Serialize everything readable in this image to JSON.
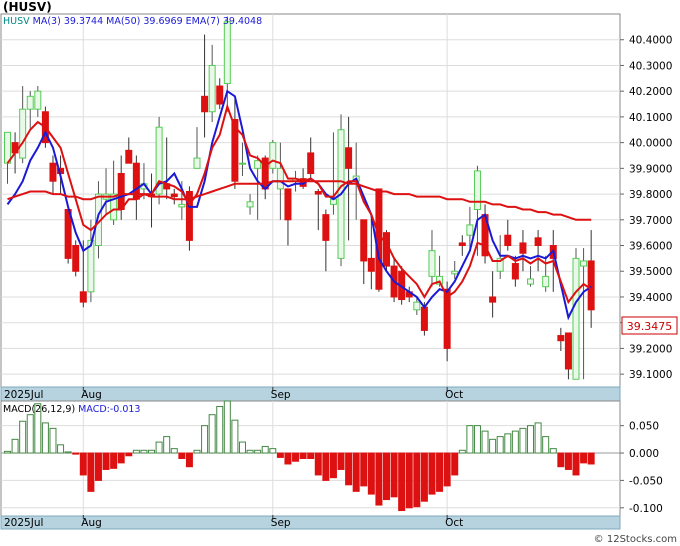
{
  "title": "(HUSV)",
  "watermark": "© 12Stocks.com",
  "colors": {
    "up": "#55cc55",
    "up_fill": "#eaf8ea",
    "down": "#dd1111",
    "ma3": "#1a1ad6",
    "ma50": "#dd1111",
    "ema7": "#dd1111",
    "macd_up": "#448844",
    "macd_down": "#dd1111",
    "axisbar": "#b7d3e0",
    "price_box": "#cc0000"
  },
  "chart_data": [
    {
      "type": "candlestick",
      "ticker": "HUSV",
      "legend": [
        {
          "label": "HUSV",
          "color": "#008888"
        },
        {
          "label": "MA(3)",
          "value": "39.3744",
          "color": "#1a1ad6"
        },
        {
          "label": "MA(50)",
          "value": "39.6969",
          "color": "#1a1ad6"
        },
        {
          "label": "EMA(7)",
          "value": "39.4048",
          "color": "#1a1ad6"
        }
      ],
      "last_price": "39.3475",
      "ylim": [
        39.05,
        40.5
      ],
      "yticks": [
        "39.1000",
        "39.2000",
        "39.3000",
        "39.4000",
        "39.5000",
        "39.6000",
        "39.7000",
        "39.8000",
        "39.9000",
        "40.0000",
        "40.1000",
        "40.2000",
        "40.3000",
        "40.4000"
      ],
      "xticks": [
        {
          "label": "2025Jul",
          "index": -0.5
        },
        {
          "label": "Aug",
          "index": 10
        },
        {
          "label": "Sep",
          "index": 35
        },
        {
          "label": "Oct",
          "index": 58
        }
      ],
      "candles": [
        [
          39.92,
          40.04,
          40.04,
          39.84
        ],
        [
          40.0,
          39.96,
          40.04,
          39.88
        ],
        [
          39.94,
          40.13,
          40.22,
          39.92
        ],
        [
          40.13,
          40.18,
          40.2,
          40.05
        ],
        [
          40.13,
          40.2,
          40.22,
          40.1
        ],
        [
          40.12,
          40.0,
          40.14,
          39.98
        ],
        [
          39.92,
          39.85,
          39.95,
          39.8
        ],
        [
          39.9,
          39.88,
          39.95,
          39.8
        ],
        [
          39.74,
          39.55,
          39.75,
          39.53
        ],
        [
          39.6,
          39.5,
          39.62,
          39.48
        ],
        [
          39.42,
          39.38,
          39.62,
          39.36
        ],
        [
          39.42,
          39.62,
          39.7,
          39.38
        ],
        [
          39.6,
          39.8,
          39.85,
          39.55
        ],
        [
          39.78,
          39.8,
          39.9,
          39.72
        ],
        [
          39.7,
          39.8,
          39.93,
          39.68
        ],
        [
          39.88,
          39.74,
          39.95,
          39.7
        ],
        [
          39.97,
          39.92,
          40.02,
          39.92
        ],
        [
          39.92,
          39.78,
          39.95,
          39.7
        ],
        [
          39.82,
          39.84,
          39.92,
          39.78
        ],
        [
          39.8,
          39.79,
          39.88,
          39.67
        ],
        [
          39.8,
          40.06,
          40.1,
          39.76
        ],
        [
          39.84,
          39.82,
          40.02,
          39.78
        ],
        [
          39.8,
          39.79,
          39.82,
          39.76
        ],
        [
          39.75,
          39.76,
          39.85,
          39.7
        ],
        [
          39.81,
          39.62,
          39.83,
          39.58
        ],
        [
          39.9,
          39.94,
          40.06,
          39.9
        ],
        [
          40.18,
          40.12,
          40.42,
          40.02
        ],
        [
          40.12,
          40.3,
          40.38,
          40.08
        ],
        [
          40.22,
          40.15,
          40.25,
          40.13
        ],
        [
          40.23,
          40.47,
          40.49,
          40.12
        ],
        [
          40.09,
          39.85,
          40.17,
          39.82
        ],
        [
          39.92,
          39.92,
          40.0,
          39.87
        ],
        [
          39.75,
          39.77,
          39.8,
          39.72
        ],
        [
          39.9,
          39.93,
          39.95,
          39.7
        ],
        [
          39.94,
          39.82,
          39.95,
          39.78
        ],
        [
          39.9,
          40.0,
          40.01,
          39.88
        ],
        [
          39.82,
          39.9,
          40.0,
          39.7
        ],
        [
          39.82,
          39.7,
          39.82,
          39.6
        ],
        [
          39.85,
          39.86,
          39.89,
          39.81
        ],
        [
          39.86,
          39.83,
          39.9,
          39.82
        ],
        [
          39.96,
          39.88,
          40.02,
          39.86
        ],
        [
          39.81,
          39.8,
          39.82,
          39.66
        ],
        [
          39.72,
          39.62,
          39.74,
          39.5
        ],
        [
          39.76,
          39.78,
          40.04,
          39.72
        ],
        [
          39.55,
          40.05,
          40.11,
          39.52
        ],
        [
          39.98,
          39.9,
          40.1,
          39.62
        ],
        [
          39.85,
          39.87,
          40.0,
          39.7
        ],
        [
          39.7,
          39.54,
          39.7,
          39.45
        ],
        [
          39.55,
          39.5,
          39.72,
          39.43
        ],
        [
          39.82,
          39.43,
          39.82,
          39.42
        ],
        [
          39.65,
          39.52,
          39.66,
          39.5
        ],
        [
          39.52,
          39.4,
          39.55,
          39.38
        ],
        [
          39.5,
          39.39,
          39.52,
          39.37
        ],
        [
          39.42,
          39.4,
          39.44,
          39.38
        ],
        [
          39.35,
          39.38,
          39.4,
          39.33
        ],
        [
          39.36,
          39.27,
          39.38,
          39.25
        ],
        [
          39.48,
          39.58,
          39.66,
          39.44
        ],
        [
          39.45,
          39.48,
          39.56,
          39.44
        ],
        [
          39.43,
          39.2,
          39.46,
          39.15
        ],
        [
          39.49,
          39.5,
          39.54,
          39.47
        ],
        [
          39.61,
          39.6,
          39.64,
          39.56
        ],
        [
          39.64,
          39.68,
          39.75,
          39.58
        ],
        [
          39.74,
          39.89,
          39.91,
          39.56
        ],
        [
          39.72,
          39.56,
          39.76,
          39.53
        ],
        [
          39.4,
          39.38,
          39.5,
          39.32
        ],
        [
          39.5,
          39.55,
          39.64,
          39.47
        ],
        [
          39.64,
          39.6,
          39.7,
          39.58
        ],
        [
          39.53,
          39.47,
          39.56,
          39.44
        ],
        [
          39.61,
          39.57,
          39.66,
          39.5
        ],
        [
          39.45,
          39.47,
          39.52,
          39.44
        ],
        [
          39.63,
          39.6,
          39.66,
          39.5
        ],
        [
          39.44,
          39.48,
          39.56,
          39.42
        ],
        [
          39.6,
          39.55,
          39.66,
          39.42
        ],
        [
          39.25,
          39.23,
          39.28,
          39.19
        ],
        [
          39.26,
          39.12,
          39.26,
          39.08
        ],
        [
          39.08,
          39.55,
          39.59,
          39.09
        ],
        [
          39.52,
          39.54,
          39.59,
          39.08
        ],
        [
          39.54,
          39.35,
          39.66,
          39.28
        ]
      ],
      "series": [
        {
          "name": "MA(3)",
          "values": [
            39.76,
            39.8,
            39.85,
            39.93,
            39.98,
            40.04,
            39.98,
            39.87,
            39.75,
            39.65,
            39.58,
            39.6,
            39.72,
            39.77,
            39.78,
            39.79,
            39.8,
            39.82,
            39.84,
            39.8,
            39.84,
            39.85,
            39.88,
            39.82,
            39.75,
            39.75,
            39.85,
            40.0,
            40.1,
            40.2,
            40.18,
            40.05,
            39.9,
            39.85,
            39.82,
            39.85,
            39.85,
            39.83,
            39.84,
            39.84,
            39.86,
            39.84,
            39.8,
            39.78,
            39.8,
            39.84,
            39.86,
            39.79,
            39.72,
            39.55,
            39.5,
            39.46,
            39.44,
            39.42,
            39.4,
            39.36,
            39.4,
            39.43,
            39.42,
            39.46,
            39.52,
            39.58,
            39.7,
            39.72,
            39.62,
            39.56,
            39.56,
            39.55,
            39.56,
            39.55,
            39.56,
            39.55,
            39.58,
            39.45,
            39.32,
            39.38,
            39.42,
            39.44
          ]
        },
        {
          "name": "MA(50)",
          "values": [
            39.78,
            39.79,
            39.8,
            39.81,
            39.81,
            39.81,
            39.8,
            39.8,
            39.79,
            39.79,
            39.78,
            39.78,
            39.79,
            39.79,
            39.79,
            39.8,
            39.8,
            39.8,
            39.8,
            39.79,
            39.79,
            39.79,
            39.78,
            39.78,
            39.78,
            39.79,
            39.8,
            39.81,
            39.82,
            39.83,
            39.84,
            39.84,
            39.84,
            39.84,
            39.84,
            39.85,
            39.85,
            39.85,
            39.85,
            39.85,
            39.85,
            39.85,
            39.85,
            39.85,
            39.85,
            39.84,
            39.84,
            39.83,
            39.82,
            39.81,
            39.81,
            39.8,
            39.8,
            39.8,
            39.79,
            39.79,
            39.79,
            39.79,
            39.78,
            39.78,
            39.78,
            39.77,
            39.77,
            39.77,
            39.76,
            39.76,
            39.75,
            39.75,
            39.74,
            39.74,
            39.73,
            39.73,
            39.72,
            39.72,
            39.71,
            39.7,
            39.7,
            39.7
          ]
        },
        {
          "name": "EMA(7)",
          "values": [
            39.92,
            39.96,
            40.0,
            40.05,
            40.08,
            40.06,
            40.02,
            39.98,
            39.88,
            39.78,
            39.68,
            39.66,
            39.69,
            39.72,
            39.74,
            39.74,
            39.78,
            39.78,
            39.8,
            39.8,
            39.85,
            39.84,
            39.83,
            39.81,
            39.76,
            39.8,
            39.88,
            39.98,
            40.03,
            40.14,
            40.06,
            40.03,
            39.95,
            39.94,
            39.91,
            39.93,
            39.92,
            39.86,
            39.86,
            39.85,
            39.86,
            39.84,
            39.79,
            39.79,
            39.83,
            39.85,
            39.85,
            39.77,
            39.72,
            39.64,
            39.61,
            39.55,
            39.51,
            39.48,
            39.45,
            39.4,
            39.45,
            39.46,
            39.4,
            39.42,
            39.46,
            39.52,
            39.61,
            39.6,
            39.54,
            39.54,
            39.56,
            39.54,
            39.55,
            39.53,
            39.55,
            39.53,
            39.54,
            39.46,
            39.38,
            39.42,
            39.45,
            39.43
          ]
        }
      ]
    },
    {
      "type": "bar",
      "legend": [
        {
          "label": "MACD(26,12,9)",
          "color": "#000000"
        },
        {
          "label": "MACD:-0.013",
          "color": "#1a1ad6"
        }
      ],
      "ylim": [
        -0.115,
        0.095
      ],
      "yticks": [
        "0.050",
        "0.000",
        "-0.050",
        "-0.100"
      ],
      "xticks": [
        {
          "label": "2025Jul",
          "index": -0.5
        },
        {
          "label": "Aug",
          "index": 10
        },
        {
          "label": "Sep",
          "index": 35
        },
        {
          "label": "Oct",
          "index": 58
        }
      ],
      "values": [
        0.003,
        0.025,
        0.058,
        0.07,
        0.09,
        0.055,
        0.045,
        0.015,
        0.002,
        -0.002,
        -0.04,
        -0.07,
        -0.05,
        -0.03,
        -0.028,
        -0.018,
        -0.005,
        0.005,
        0.005,
        0.005,
        0.02,
        0.03,
        0.008,
        -0.01,
        -0.025,
        0.005,
        0.05,
        0.07,
        0.085,
        0.095,
        0.06,
        0.02,
        0.005,
        0.005,
        0.012,
        0.008,
        -0.008,
        -0.02,
        -0.015,
        -0.01,
        -0.01,
        -0.04,
        -0.05,
        -0.045,
        -0.03,
        -0.058,
        -0.07,
        -0.06,
        -0.075,
        -0.095,
        -0.085,
        -0.08,
        -0.105,
        -0.1,
        -0.098,
        -0.088,
        -0.075,
        -0.07,
        -0.06,
        -0.04,
        0.005,
        0.05,
        0.05,
        0.04,
        0.025,
        0.03,
        0.035,
        0.04,
        0.045,
        0.05,
        0.055,
        0.03,
        0.008,
        -0.025,
        -0.03,
        -0.04,
        -0.018,
        -0.02
      ]
    }
  ]
}
